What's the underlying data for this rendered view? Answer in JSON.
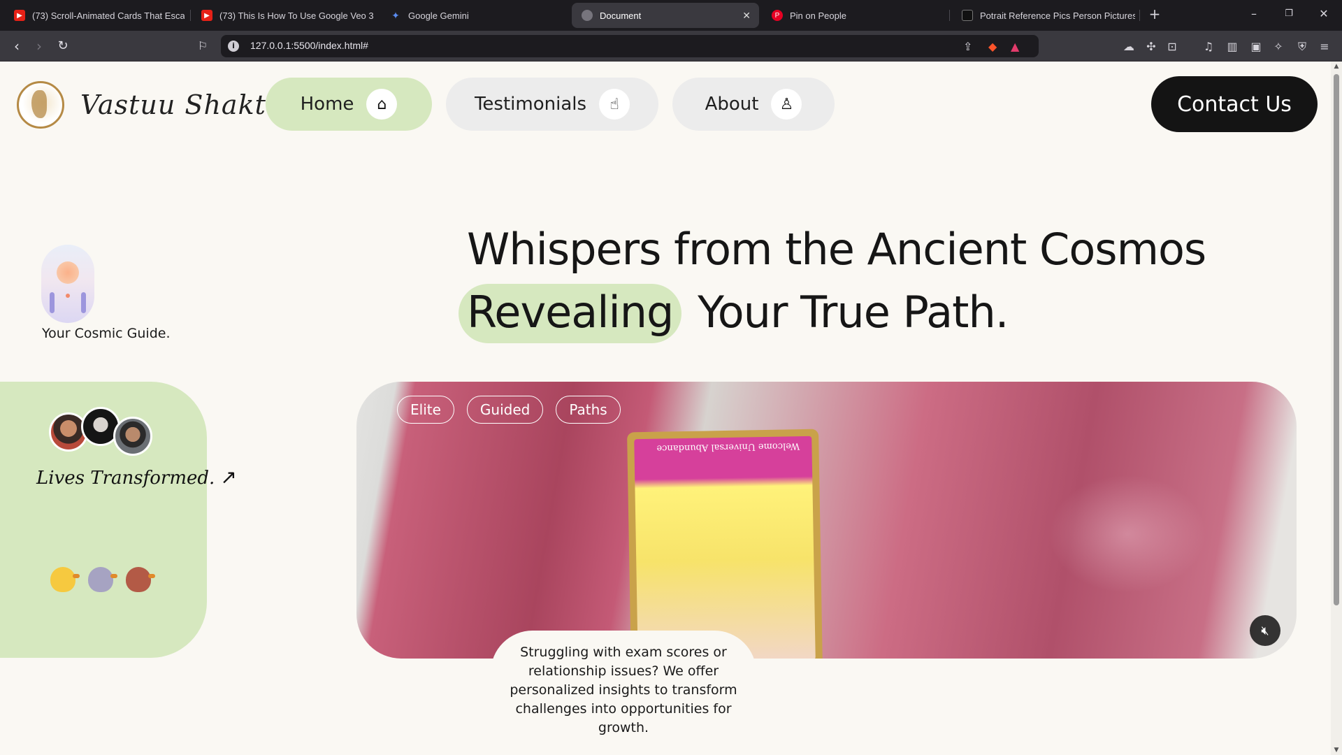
{
  "browser": {
    "tabs": [
      {
        "title": "(73) Scroll-Animated Cards That Escap",
        "favicon": "youtube-icon"
      },
      {
        "title": "(73) This Is How To Use Google Veo 3",
        "favicon": "youtube-icon"
      },
      {
        "title": "Google Gemini",
        "favicon": "gemini-icon"
      },
      {
        "title": "Document",
        "favicon": "globe-icon",
        "active": true
      },
      {
        "title": "Pin on People",
        "favicon": "pinterest-icon"
      },
      {
        "title": "Potrait Reference Pics Person Pictures",
        "favicon": "generic-icon"
      }
    ],
    "new_tab": "+",
    "close_tab": "✕",
    "url": "127.0.0.1:5500/index.html#"
  },
  "site": {
    "logo_text": "Vastuu Shaktee",
    "nav": {
      "home": "Home",
      "testimonials": "Testimonials",
      "about": "About",
      "contact": "Contact Us"
    },
    "guide_caption": "Your Cosmic Guide.",
    "hero": {
      "line1": "Whispers from the Ancient Cosmos",
      "highlight": "Revealing",
      "line2_rest": "Your True Path."
    },
    "lives": {
      "text": "Lives Transformed.",
      "arrow": "↗"
    },
    "video": {
      "tags": [
        "Elite",
        "Guided",
        "Paths"
      ],
      "card_text": "Welcome Universal Abundance"
    },
    "description": "Struggling with exam scores or relationship issues? We offer personalized insights to transform challenges into opportunities for growth."
  },
  "colors": {
    "accent_green": "#d6e8bf",
    "contact_bg": "#141414",
    "page_bg": "#faf8f3"
  }
}
